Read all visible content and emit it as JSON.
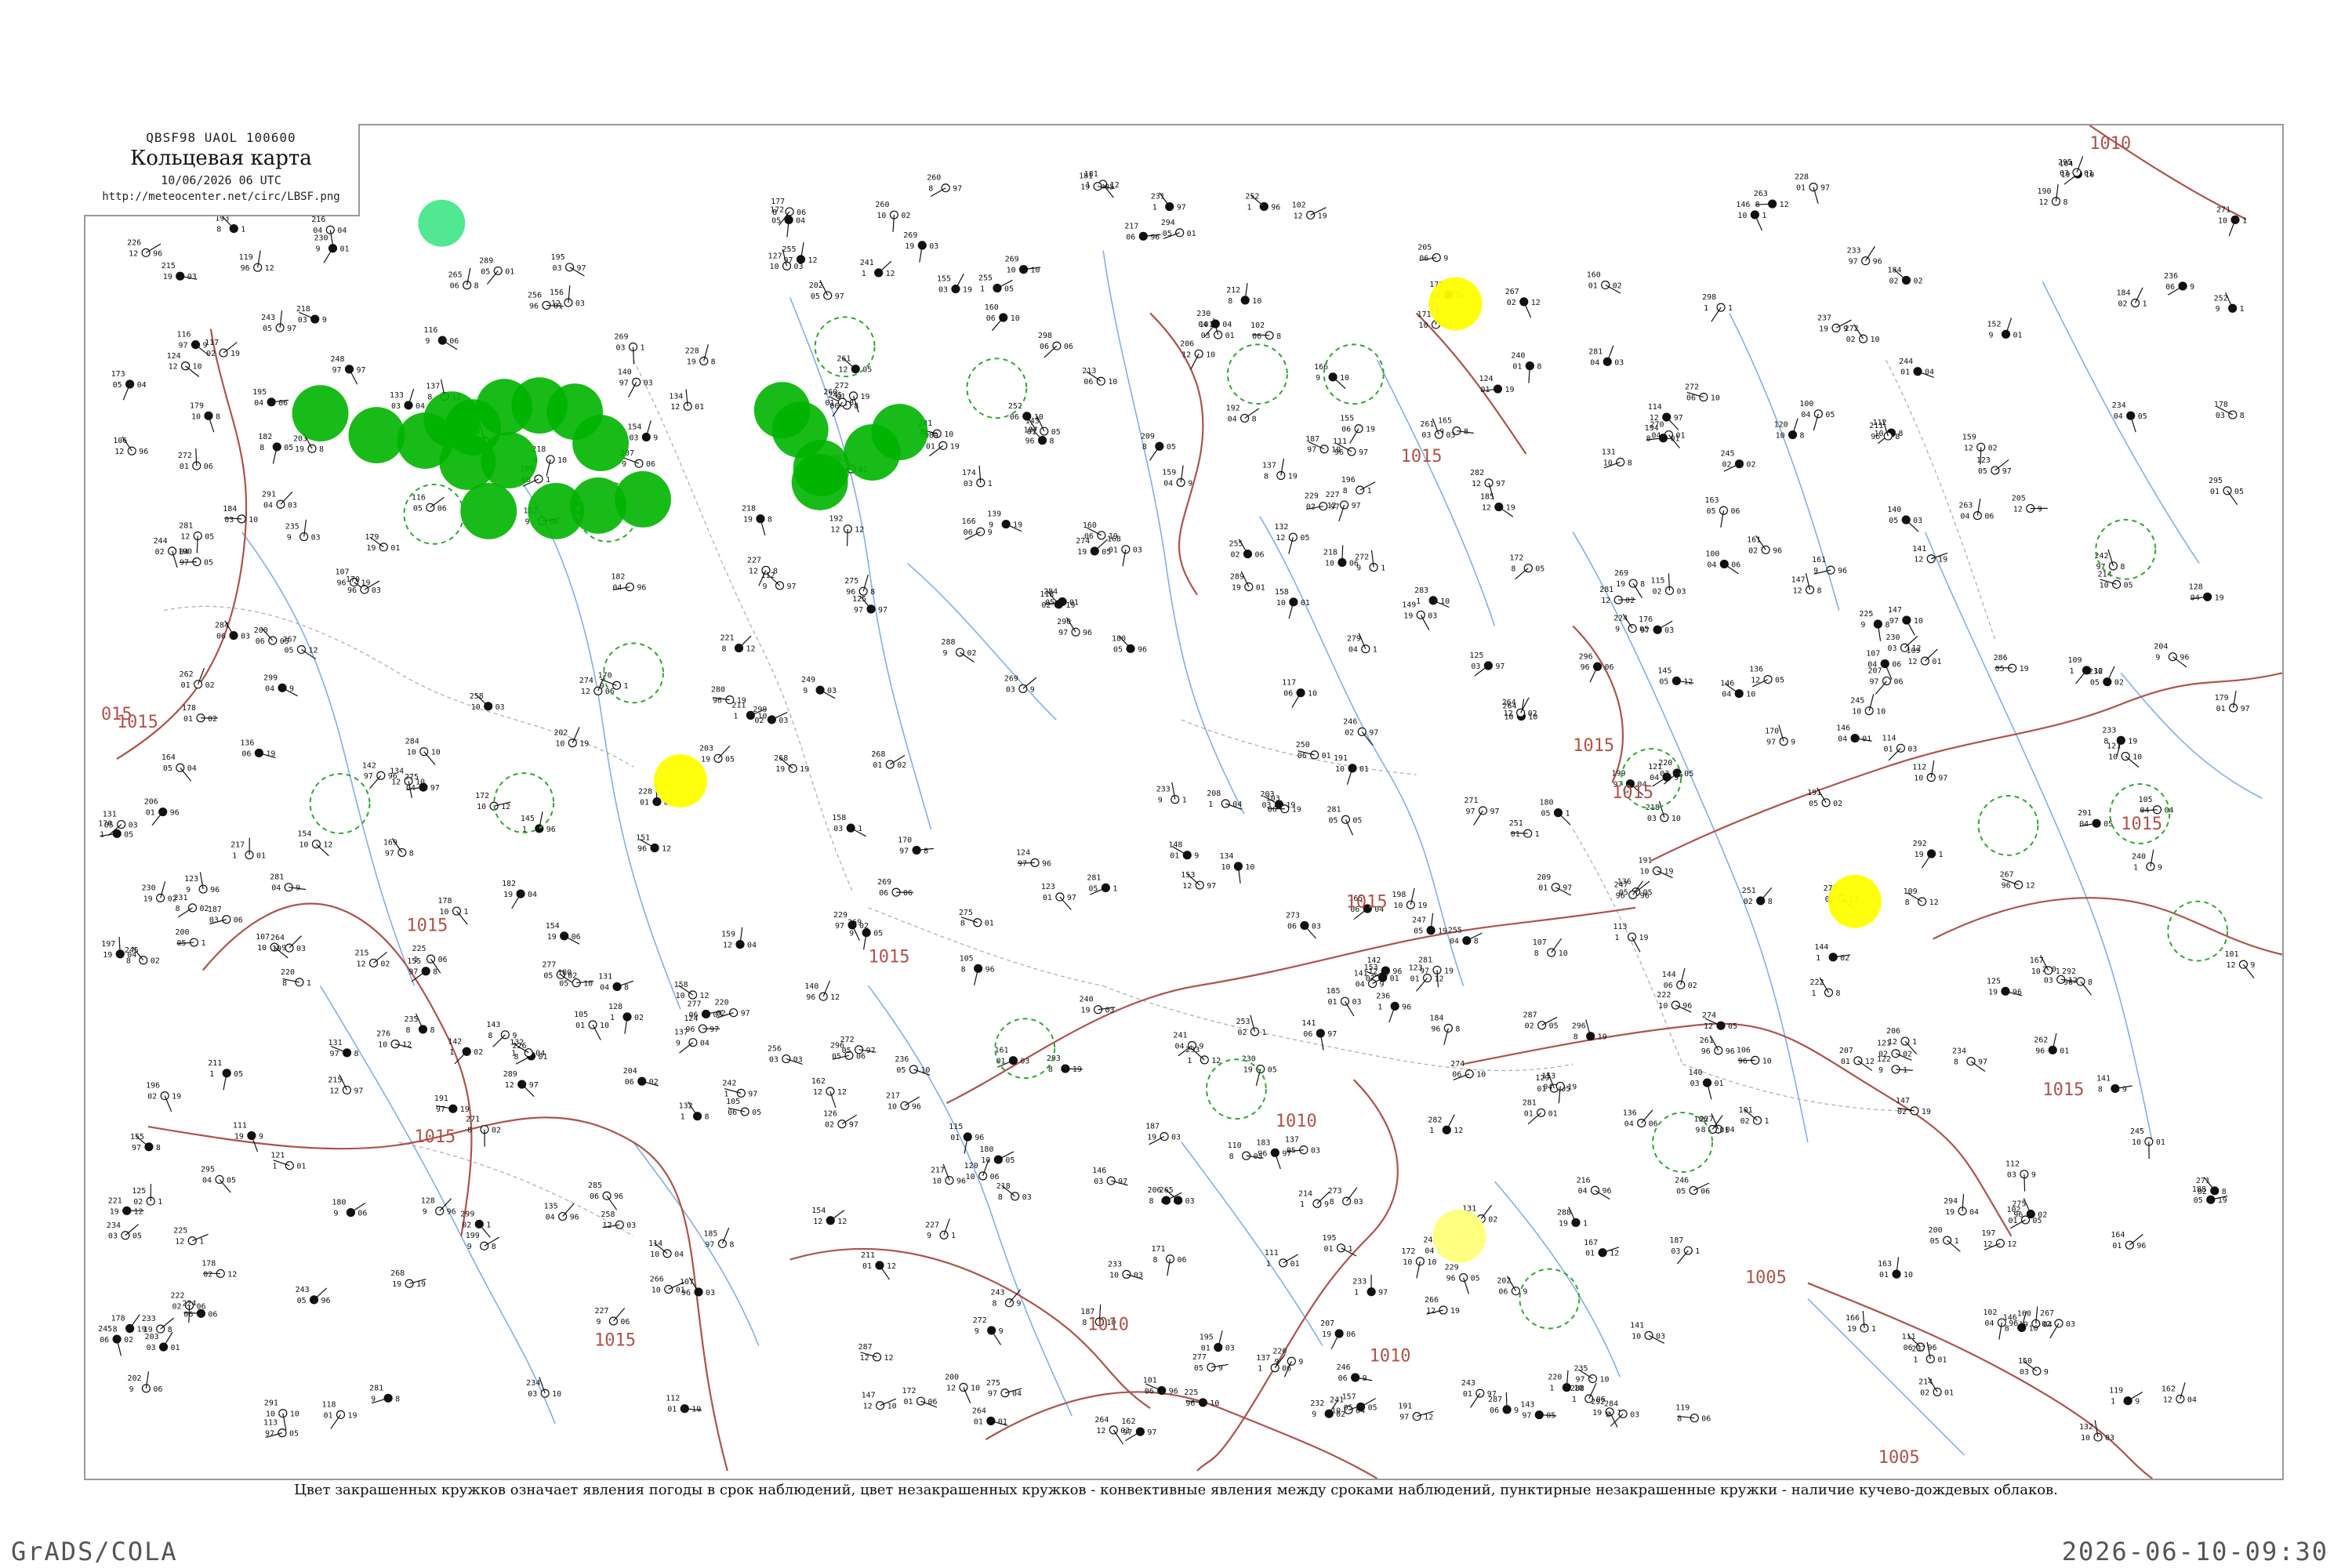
{
  "header": {
    "code": "QBSF98  UAOL  100600",
    "title": "Кольцевая карта",
    "datetime": "10/06/2026 06 UTC",
    "url": "http://meteocenter.net/circ/LBSF.png"
  },
  "caption": "Цвет закрашенных кружков означает явления погоды в срок наблюдений, цвет незакрашенных кружков - конвективные явления между сроками наблюдений, пунктирные незакрашенные кружки - наличие кучево-дождевых облаков.",
  "footer": {
    "left": "GrADS/COLA",
    "right": "2026-06-10-09:30"
  },
  "colors": {
    "isobar": "#b0524a",
    "river": "#7fb0e8",
    "border": "#aaaaaa",
    "rain_marker": "#00b400",
    "shower_marker": "#50e890",
    "fog_marker": "#ffff00",
    "fog_marker_light": "#ffff80",
    "cb_marker": "#2ea82e"
  },
  "isobars": [
    {
      "label": "1010",
      "position": "top-right"
    },
    {
      "label": "1015",
      "position": "upper-middle-right"
    },
    {
      "label": "1015",
      "position": "upper-middle"
    },
    {
      "label": "1015",
      "position": "middle"
    },
    {
      "label": "1015",
      "position": "left"
    },
    {
      "label": "1015",
      "position": "far-left"
    },
    {
      "label": "1015",
      "position": "lower-left"
    },
    {
      "label": "1015",
      "position": "bottom-left"
    },
    {
      "label": "1015",
      "position": "right"
    },
    {
      "label": "1015",
      "position": "far-right"
    },
    {
      "label": "1015",
      "position": "center-right"
    },
    {
      "label": "1010",
      "position": "lower-middle"
    },
    {
      "label": "1010",
      "position": "bottom-middle"
    },
    {
      "label": "1010",
      "position": "bottom-middle-2"
    },
    {
      "label": "1005",
      "position": "bottom-right"
    },
    {
      "label": "1005",
      "position": "bottom-right-2"
    },
    {
      "label": "1015",
      "position": "center"
    },
    {
      "label": "015",
      "position": "left-edge"
    }
  ],
  "markers": {
    "rain_count": 16,
    "shower_count": 1,
    "fog_count": 4,
    "cb_count": 18
  },
  "sample_stations": [
    {
      "id": "16",
      "values": [
        "164",
        "91",
        "03"
      ]
    },
    {
      "id": "33",
      "values": [
        "174",
        "97",
        "04"
      ]
    },
    {
      "id": "46",
      "values": [
        "134",
        "97",
        "02"
      ]
    },
    {
      "id": "84",
      "values": [
        "162",
        "96",
        "06"
      ]
    },
    {
      "id": "149",
      "values": [
        "143",
        "92",
        "03"
      ]
    }
  ]
}
